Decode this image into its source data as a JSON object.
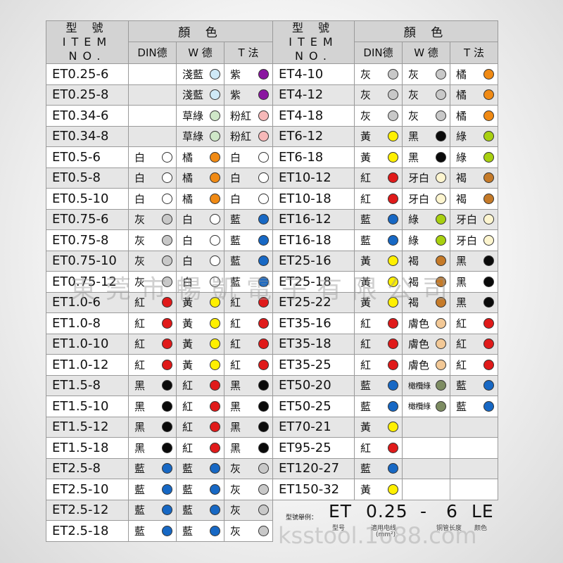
{
  "header": {
    "item_cn": "型 號",
    "item_en": "ITEM NO.",
    "color_cn": "顏 色",
    "col_din": "DIN德",
    "col_w": "W 德",
    "col_t": "T 法"
  },
  "colors": {
    "白": "#ffffff",
    "橘": "#f08a14",
    "灰": "#c8c8c8",
    "藍": "#1768c4",
    "紅": "#e01a1a",
    "黃": "#fff000",
    "黑": "#0a0a0a",
    "淺藍": "#cfe9f7",
    "紫": "#8a16a0",
    "粉紅": "#f6b8b8",
    "草綠": "#cfe7c8",
    "綠": "#a8d010",
    "牙白": "#fdf5cf",
    "褐": "#c57a28",
    "膚色": "#f2c896",
    "橄欖綠": "#7d8c62"
  },
  "rows_left": [
    {
      "item": "ET0.25-6",
      "din": "",
      "w": "淺藍",
      "t": "紫"
    },
    {
      "item": "ET0.25-8",
      "din": "",
      "w": "淺藍",
      "t": "紫"
    },
    {
      "item": "ET0.34-6",
      "din": "",
      "w": "草綠",
      "t": "粉紅"
    },
    {
      "item": "ET0.34-8",
      "din": "",
      "w": "草綠",
      "t": "粉紅"
    },
    {
      "item": "ET0.5-6",
      "din": "白",
      "w": "橘",
      "t": "白"
    },
    {
      "item": "ET0.5-8",
      "din": "白",
      "w": "橘",
      "t": "白"
    },
    {
      "item": "ET0.5-10",
      "din": "白",
      "w": "橘",
      "t": "白"
    },
    {
      "item": "ET0.75-6",
      "din": "灰",
      "w": "白",
      "t": "藍"
    },
    {
      "item": "ET0.75-8",
      "din": "灰",
      "w": "白",
      "t": "藍"
    },
    {
      "item": "ET0.75-10",
      "din": "灰",
      "w": "白",
      "t": "藍"
    },
    {
      "item": "ET0.75-12",
      "din": "灰",
      "w": "白",
      "t": "藍"
    },
    {
      "item": "ET1.0-6",
      "din": "紅",
      "w": "黃",
      "t": "紅"
    },
    {
      "item": "ET1.0-8",
      "din": "紅",
      "w": "黃",
      "t": "紅"
    },
    {
      "item": "ET1.0-10",
      "din": "紅",
      "w": "黃",
      "t": "紅"
    },
    {
      "item": "ET1.0-12",
      "din": "紅",
      "w": "黃",
      "t": "紅"
    },
    {
      "item": "ET1.5-8",
      "din": "黑",
      "w": "紅",
      "t": "黑"
    },
    {
      "item": "ET1.5-10",
      "din": "黑",
      "w": "紅",
      "t": "黑"
    },
    {
      "item": "ET1.5-12",
      "din": "黑",
      "w": "紅",
      "t": "黑"
    },
    {
      "item": "ET1.5-18",
      "din": "黑",
      "w": "紅",
      "t": "黑"
    },
    {
      "item": "ET2.5-8",
      "din": "藍",
      "w": "藍",
      "t": "灰"
    },
    {
      "item": "ET2.5-10",
      "din": "藍",
      "w": "藍",
      "t": "灰"
    },
    {
      "item": "ET2.5-12",
      "din": "藍",
      "w": "藍",
      "t": "灰"
    },
    {
      "item": "ET2.5-18",
      "din": "藍",
      "w": "藍",
      "t": "灰"
    }
  ],
  "rows_right": [
    {
      "item": "ET4-10",
      "din": "灰",
      "w": "灰",
      "t": "橘"
    },
    {
      "item": "ET4-12",
      "din": "灰",
      "w": "灰",
      "t": "橘"
    },
    {
      "item": "ET4-18",
      "din": "灰",
      "w": "灰",
      "t": "橘"
    },
    {
      "item": "ET6-12",
      "din": "黃",
      "w": "黑",
      "t": "綠"
    },
    {
      "item": "ET6-18",
      "din": "黃",
      "w": "黑",
      "t": "綠"
    },
    {
      "item": "ET10-12",
      "din": "紅",
      "w": "牙白",
      "t": "褐"
    },
    {
      "item": "ET10-18",
      "din": "紅",
      "w": "牙白",
      "t": "褐"
    },
    {
      "item": "ET16-12",
      "din": "藍",
      "w": "綠",
      "t": "牙白"
    },
    {
      "item": "ET16-18",
      "din": "藍",
      "w": "綠",
      "t": "牙白"
    },
    {
      "item": "ET25-16",
      "din": "黃",
      "w": "褐",
      "t": "黑"
    },
    {
      "item": "ET25-18",
      "din": "黃",
      "w": "褐",
      "t": "黑"
    },
    {
      "item": "ET25-22",
      "din": "黃",
      "w": "褐",
      "t": "黑"
    },
    {
      "item": "ET35-16",
      "din": "紅",
      "w": "膚色",
      "t": "紅"
    },
    {
      "item": "ET35-18",
      "din": "紅",
      "w": "膚色",
      "t": "紅"
    },
    {
      "item": "ET35-25",
      "din": "紅",
      "w": "膚色",
      "t": "紅"
    },
    {
      "item": "ET50-20",
      "din": "藍",
      "w": "橄欖綠",
      "t": "藍"
    },
    {
      "item": "ET50-25",
      "din": "藍",
      "w": "橄欖綠",
      "t": "藍"
    },
    {
      "item": "ET70-21",
      "din": "黃",
      "w": "",
      "t": ""
    },
    {
      "item": "ET95-25",
      "din": "紅",
      "w": "",
      "t": ""
    },
    {
      "item": "ET120-27",
      "din": "藍",
      "w": "",
      "t": ""
    },
    {
      "item": "ET150-32",
      "din": "黃",
      "w": "",
      "t": ""
    }
  ],
  "example": {
    "lead": "型號舉例：",
    "parts": [
      {
        "code": "ET",
        "caption": "型号"
      },
      {
        "code": "0.25",
        "caption": "適用电线"
      },
      {
        "code": "-",
        "caption": ""
      },
      {
        "code": "6",
        "caption": "铜管长度"
      },
      {
        "code": "LE",
        "caption": "颜色"
      }
    ],
    "unit": "(mm²)"
  },
  "watermark": {
    "company": "東莞市暢凱電子有限公司",
    "site": "ksstool.1688.com"
  }
}
